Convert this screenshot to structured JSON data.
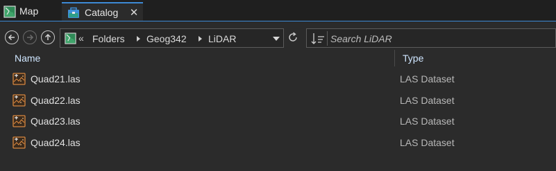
{
  "tabs": [
    {
      "label": "Map",
      "icon": "map-icon",
      "active": false
    },
    {
      "label": "Catalog",
      "icon": "catalog-icon",
      "active": true,
      "close": "✕"
    }
  ],
  "nav": {
    "back_icon": "arrow-left-icon",
    "forward_icon": "arrow-right-icon",
    "up_icon": "arrow-up-icon",
    "breadcrumb": {
      "overflow": "«",
      "items": [
        "Folders",
        "Geog342",
        "LiDAR"
      ]
    },
    "search": {
      "placeholder": "Search LiDAR",
      "value": ""
    }
  },
  "list": {
    "columns": {
      "name": "Name",
      "type": "Type"
    },
    "rows": [
      {
        "name": "Quad21.las",
        "type": "LAS Dataset"
      },
      {
        "name": "Quad22.las",
        "type": "LAS Dataset"
      },
      {
        "name": "Quad23.las",
        "type": "LAS Dataset"
      },
      {
        "name": "Quad24.las",
        "type": "LAS Dataset"
      }
    ]
  },
  "colors": {
    "accent": "#3d8ad6",
    "background": "#2b2b2b",
    "tabstrip": "#1f1f1f",
    "las_icon": "#d7873f"
  }
}
